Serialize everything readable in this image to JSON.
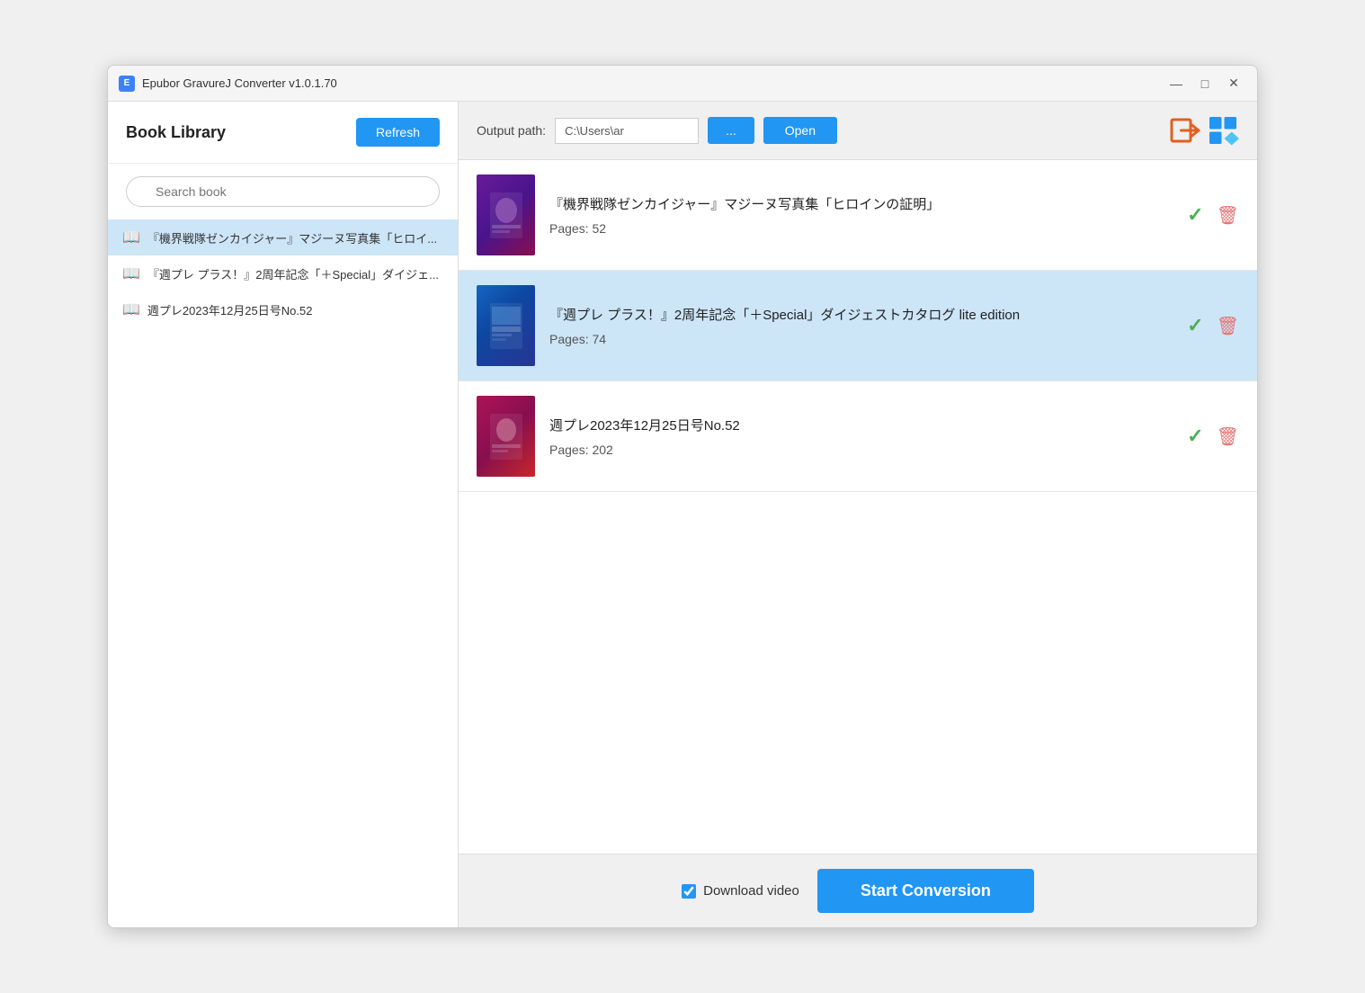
{
  "window": {
    "title": "Epubor GravureJ Converter v1.0.1.70"
  },
  "title_bar_controls": {
    "minimize": "—",
    "maximize": "□",
    "close": "✕"
  },
  "sidebar": {
    "title": "Book Library",
    "refresh_label": "Refresh",
    "search_placeholder": "Search book",
    "books": [
      {
        "id": "book1",
        "label": "『機界戦隊ゼンカイジャー』マジーヌ写真集「ヒロイ..."
      },
      {
        "id": "book2",
        "label": "『週プレ プラス！』2周年記念「＋Special」ダイジェ..."
      },
      {
        "id": "book3",
        "label": "週プレ2023年12月25日号No.52"
      }
    ]
  },
  "output_bar": {
    "label": "Output path:",
    "path_value": "C:\\Users\\ar",
    "browse_label": "...",
    "open_label": "Open"
  },
  "book_entries": [
    {
      "id": "entry1",
      "title": "『機界戦隊ゼンカイジャー』マジーヌ写真集「ヒロインの証明」",
      "pages_label": "Pages:",
      "pages": "52",
      "thumb_class": "book-thumb-1",
      "highlighted": false
    },
    {
      "id": "entry2",
      "title": "『週プレ プラス！』2周年記念「＋Special」ダイジェストカタログ lite edition",
      "pages_label": "Pages:",
      "pages": "74",
      "thumb_class": "book-thumb-2",
      "highlighted": true
    },
    {
      "id": "entry3",
      "title": "週プレ2023年12月25日号No.52",
      "pages_label": "Pages:",
      "pages": "202",
      "thumb_class": "book-thumb-3",
      "highlighted": false
    }
  ],
  "bottom_bar": {
    "download_video_label": "Download video",
    "start_conversion_label": "Start Conversion",
    "download_checked": true
  }
}
